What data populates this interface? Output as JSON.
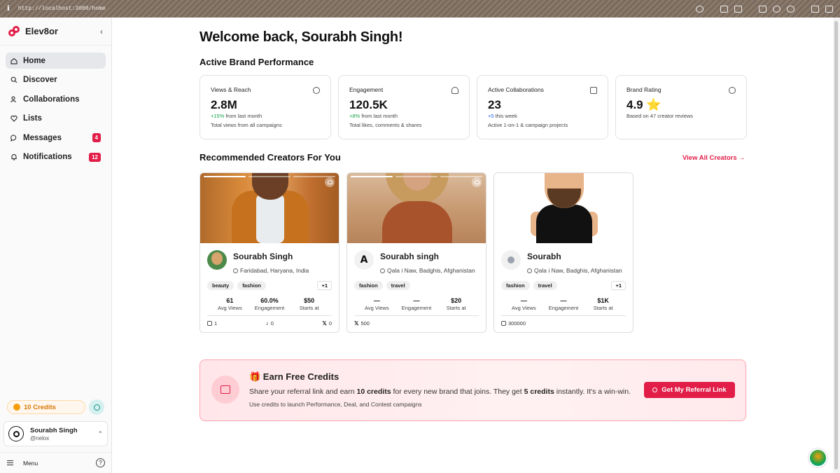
{
  "browser": {
    "url": "http://localhost:3000/home",
    "info_glyph": "i"
  },
  "sidebar": {
    "brand": "Elev8or",
    "items": [
      {
        "label": "Home",
        "icon": "home-icon",
        "active": true
      },
      {
        "label": "Discover",
        "icon": "search-icon"
      },
      {
        "label": "Collaborations",
        "icon": "users-icon"
      },
      {
        "label": "Lists",
        "icon": "heart-icon"
      },
      {
        "label": "Messages",
        "icon": "message-icon",
        "badge": "4"
      },
      {
        "label": "Notifications",
        "icon": "bell-icon",
        "badge": "12"
      }
    ],
    "credits": "10 Credits",
    "user": {
      "name": "Sourabh Singh",
      "handle": "@nelox"
    },
    "menu": "Menu",
    "help": "?"
  },
  "main": {
    "greeting": "Welcome back, Sourabh Singh!",
    "performance_title": "Active Brand Performance",
    "stats": [
      {
        "label": "Views & Reach",
        "value": "2.8M",
        "delta": "+15%",
        "delta_text": "from last month",
        "desc": "Total views from all campaigns",
        "icon": "eye-icon"
      },
      {
        "label": "Engagement",
        "value": "120.5K",
        "delta": "+8%",
        "delta_text": "from last month",
        "desc": "Total likes, comments & shares",
        "icon": "heart-icon"
      },
      {
        "label": "Active Collaborations",
        "value": "23",
        "delta": "+5",
        "delta_text": "this week",
        "desc": "Active 1-on-1 & campaign projects",
        "icon": "briefcase-icon"
      },
      {
        "label": "Brand Rating",
        "value": "4.9 ⭐",
        "delta": "",
        "delta_text": "Based on 47 creator reviews",
        "desc": "",
        "icon": "star-icon"
      }
    ],
    "recommended_title": "Recommended Creators For You",
    "view_all": "View All Creators →",
    "creators": [
      {
        "name": "Sourabh Singh",
        "location": "Faridabad, Haryana, India",
        "tags": [
          "beauty",
          "fashion"
        ],
        "more": "+1",
        "metrics": [
          {
            "value": "61",
            "label": "Avg Views"
          },
          {
            "value": "60.0%",
            "label": "Engagement"
          },
          {
            "value": "$50",
            "label": "Starts at"
          }
        ],
        "footer": [
          {
            "icon": "instagram-icon",
            "value": "1"
          },
          {
            "icon": "tiktok-icon",
            "value": "0"
          },
          {
            "icon": "x-icon",
            "value": "0"
          }
        ]
      },
      {
        "name": "Sourabh singh",
        "location": "Qala i Naw, Badghis, Afghanistan",
        "tags": [
          "fashion",
          "travel"
        ],
        "more": "",
        "metrics": [
          {
            "value": "—",
            "label": "Avg Views"
          },
          {
            "value": "—",
            "label": "Engagement"
          },
          {
            "value": "$20",
            "label": "Starts at"
          }
        ],
        "footer": [
          {
            "icon": "x-icon",
            "value": "500"
          }
        ]
      },
      {
        "name": "Sourabh",
        "location": "Qala i Naw, Badghis, Afghanistan",
        "tags": [
          "fashion",
          "travel"
        ],
        "more": "+1",
        "metrics": [
          {
            "value": "—",
            "label": "Avg Views"
          },
          {
            "value": "—",
            "label": "Engagement"
          },
          {
            "value": "$1K",
            "label": "Starts at"
          }
        ],
        "footer": [
          {
            "icon": "instagram-icon",
            "value": "300000"
          }
        ]
      }
    ],
    "referral": {
      "title": "🎁 Earn Free Credits",
      "text_1": "Share your referral link and earn ",
      "bold_1": "10 credits",
      "text_2": " for every new brand that joins. They get ",
      "bold_2": "5 credits",
      "text_3": " instantly. It's a win-win.",
      "sub": "Use credits to launch Performance, Deal, and Contest campaigns",
      "button": "Get My Referral Link"
    }
  },
  "colors": {
    "accent": "#e11d48",
    "positive": "#16a34a",
    "credits": "#d97706"
  }
}
